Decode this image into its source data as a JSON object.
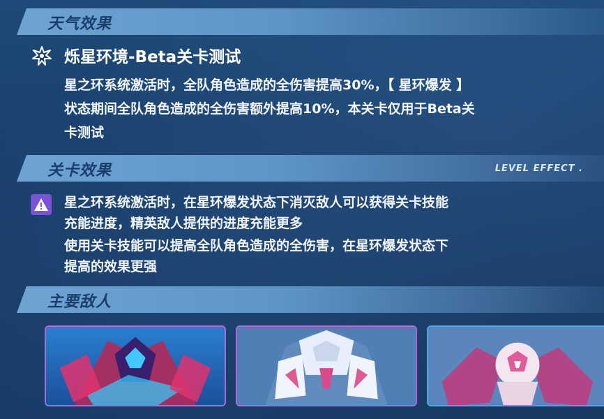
{
  "weather": {
    "header": "天气效果",
    "title": "烁星环境-Beta关卡测试",
    "desc_lines": [
      "星之环系统激活时，全队角色造成的全伤害提高30%，【 星环爆发 】",
      "状态期间全队角色造成的全伤害额外提高10%，本关卡仅用于Beta关",
      "卡测试"
    ]
  },
  "level": {
    "header": "关卡效果",
    "subheader": "LEVEL EFFECT .",
    "desc_lines": [
      "星之环系统激活时，在星环爆发状态下消灭敌人可以获得关卡技能",
      "充能进度，精英敌人提供的进度充能更多",
      "使用关卡技能可以提高全队角色造成的全伤害，在星环爆发状态下",
      "提高的效果更强"
    ]
  },
  "enemies": {
    "header": "主要敌人",
    "cards": [
      {
        "name": "enemy-1",
        "accent": "#e0336e"
      },
      {
        "name": "enemy-2",
        "accent": "#d94a8a"
      },
      {
        "name": "enemy-3",
        "accent": "#e05c9a"
      }
    ]
  },
  "colors": {
    "header_bg": "#6ea3d2",
    "header_text": "#1a3e6c",
    "warning_badge": "#7a53d6"
  }
}
